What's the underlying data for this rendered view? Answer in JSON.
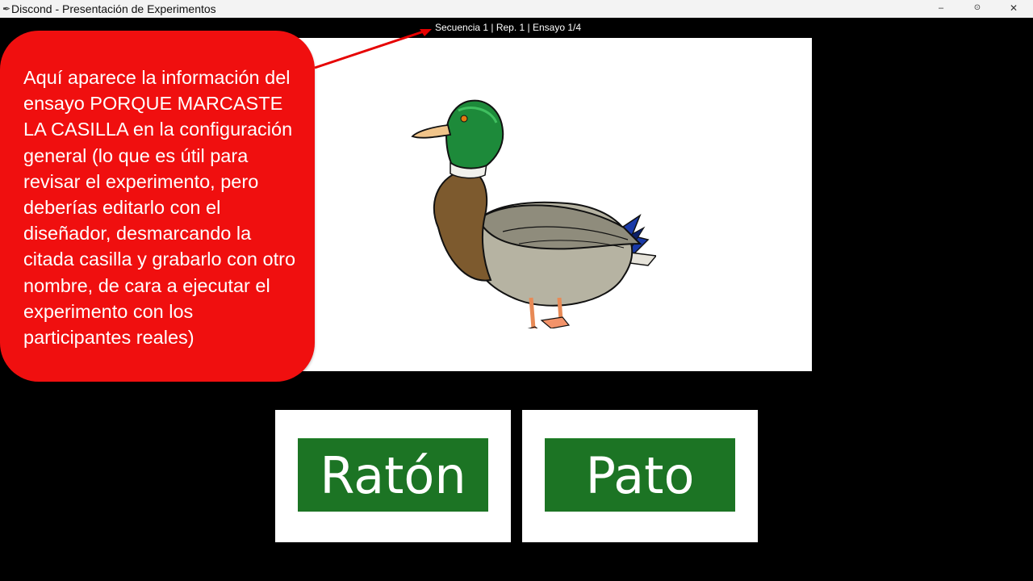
{
  "window": {
    "title": "Discond - Presentación de Experimentos",
    "icon": "feather-icon",
    "buttons": {
      "minimize": "–",
      "maximize": "⊙",
      "close": "✕"
    }
  },
  "trial_info": "Secuencia 1 | Rep. 1 | Ensayo 1/4",
  "stimulus": {
    "image": "mallard-duck"
  },
  "callout": {
    "text": "Aquí aparece la información del ensayo PORQUE MARCASTE LA CASILLA en la configuración general  (lo que es útil para revisar el experimento, pero deberías editarlo con el diseñador, desmarcando la citada casilla y grabarlo con otro nombre, de cara a ejecutar el experimento con los participantes reales)",
    "color": "#f00f0f"
  },
  "choices": [
    {
      "label": "Ratón"
    },
    {
      "label": "Pato"
    }
  ],
  "colors": {
    "background": "#000000",
    "choice_green": "#1c7424"
  }
}
